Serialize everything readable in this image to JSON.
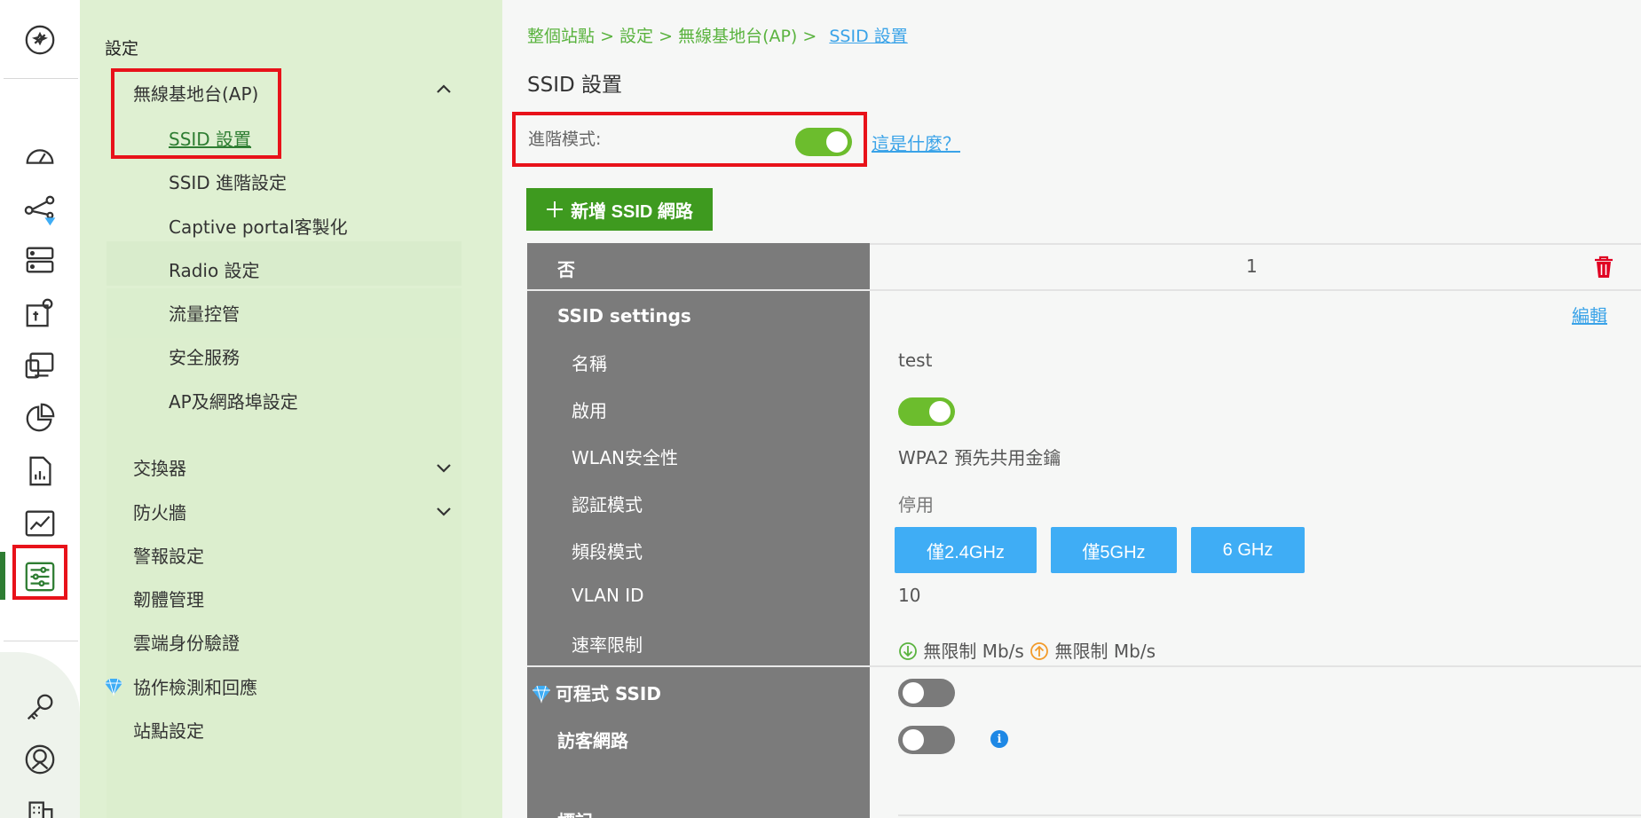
{
  "menu": {
    "title": "設定",
    "ap_group": "無線基地台(AP)",
    "ap_items": [
      "SSID 設置",
      "SSID 進階設定",
      "Captive portal客製化",
      "Radio 設定",
      "流量控管",
      "安全服務",
      "AP及網路埠設定"
    ],
    "switch": "交換器",
    "firewall": "防火牆",
    "items": [
      "警報設定",
      "韌體管理",
      "雲端身份驗證",
      "協作檢測和回應",
      "站點設定"
    ]
  },
  "breadcrumb": {
    "site": "整個站點",
    "sep": ">",
    "settings": "設定",
    "ap": "無線基地台(AP)",
    "current": "SSID 設置"
  },
  "page_title": "SSID 設置",
  "advanced": {
    "label": "進階模式:",
    "enabled": true,
    "help": "這是什麼？"
  },
  "add_button": "新增 SSID 網路",
  "table": {
    "row_head": "否",
    "ssid_number": "1",
    "section": "SSID settings",
    "edit": "編輯",
    "rows": {
      "name_label": "名稱",
      "name_value": "test",
      "enable_label": "啟用",
      "security_label": "WLAN安全性",
      "security_value": "WPA2 預先共用金鑰",
      "auth_label": "認証模式",
      "auth_value": "停用",
      "band_label": "頻段模式",
      "bands": [
        "僅2.4GHz",
        "僅5GHz",
        "6 GHz"
      ],
      "vlan_label": "VLAN ID",
      "vlan_value": "10",
      "rate_label": "速率限制",
      "rate_down": "無限制 Mb/s",
      "rate_up": "無限制 Mb/s"
    },
    "programmable_label": "可程式 SSID",
    "guest_label": "訪客網路",
    "next_label": "標記"
  },
  "colors": {
    "accent_green": "#6cbd2d",
    "button_green": "#3e9a1f",
    "highlight_red": "#e8121a",
    "band_blue": "#3fadf5",
    "link_blue": "#3aa3e8"
  }
}
